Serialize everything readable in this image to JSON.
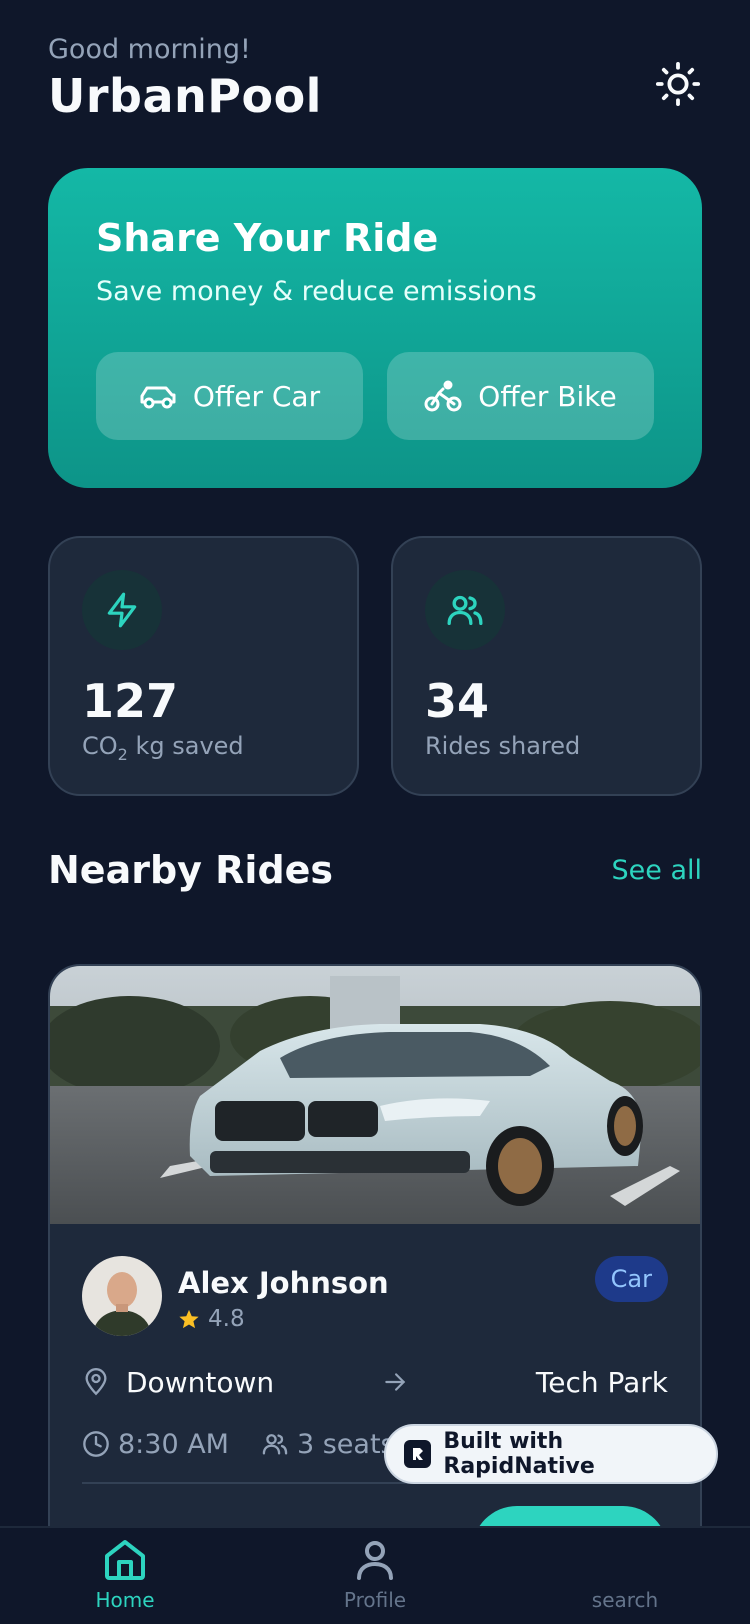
{
  "header": {
    "greeting": "Good morning!",
    "title": "UrbanPool",
    "theme_icon": "sun-icon"
  },
  "hero": {
    "title": "Share Your Ride",
    "subtitle": "Save money & reduce emissions",
    "buttons": [
      {
        "label": "Offer Car",
        "icon": "car-icon"
      },
      {
        "label": "Offer Bike",
        "icon": "bike-icon"
      }
    ],
    "colors": {
      "start": "#14b8a6",
      "end": "#0d9488"
    }
  },
  "stats": [
    {
      "value": "127",
      "label_prefix": "CO",
      "label_sub": "2",
      "label_suffix": " kg saved",
      "icon": "lightning-icon"
    },
    {
      "value": "34",
      "label": "Rides shared",
      "icon": "users-icon"
    }
  ],
  "nearby": {
    "title": "Nearby Rides",
    "see_all": "See all"
  },
  "ride": {
    "driver": "Alex Johnson",
    "rating": "4.8",
    "type_badge": "Car",
    "from": "Downtown",
    "to": "Tech Park",
    "time": "8:30 AM",
    "seats": "3 seats"
  },
  "watermark": {
    "label": "Built with RapidNative"
  },
  "tabs": [
    {
      "label": "Home",
      "icon": "home-icon",
      "active": true
    },
    {
      "label": "Profile",
      "icon": "user-icon",
      "active": false
    },
    {
      "label": "search",
      "icon": "search-icon",
      "active": false
    }
  ],
  "colors": {
    "background": "#0f172a",
    "accent": "#2dd4bf",
    "card": "#1e293b"
  }
}
